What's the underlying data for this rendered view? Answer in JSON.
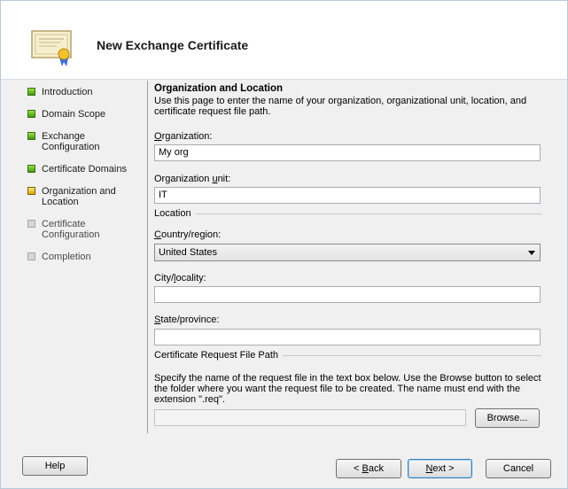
{
  "window": {
    "title": "New Exchange Certificate"
  },
  "steps": [
    {
      "label": "Introduction",
      "state": "done"
    },
    {
      "label": "Domain Scope",
      "state": "done"
    },
    {
      "label": "Exchange Configuration",
      "state": "done"
    },
    {
      "label": "Certificate Domains",
      "state": "done"
    },
    {
      "label": "Organization and Location",
      "state": "current"
    },
    {
      "label": "Certificate Configuration",
      "state": "pending"
    },
    {
      "label": "Completion",
      "state": "pending"
    }
  ],
  "page": {
    "heading": "Organization and Location",
    "description": "Use this page to enter the name of your organization, organizational unit, location, and certificate request file path."
  },
  "fields": {
    "organization": {
      "label_pre": "",
      "label_u": "O",
      "label_post": "rganization:",
      "value": "My org"
    },
    "org_unit": {
      "label_pre": "Organization ",
      "label_u": "u",
      "label_post": "nit:",
      "value": "IT"
    },
    "location_group": "Location",
    "country": {
      "label_pre": "",
      "label_u": "C",
      "label_post": "ountry/region:",
      "value": "United States"
    },
    "city": {
      "label_pre": "City/",
      "label_u": "l",
      "label_post": "ocality:",
      "value": ""
    },
    "state": {
      "label_pre": "",
      "label_u": "S",
      "label_post": "tate/province:",
      "value": ""
    },
    "file_group": "Certificate Request File Path",
    "file_desc": "Specify the name of the request file in the text box below. Use the Browse button to select the folder where you want the request file to be created. The name must end with the extension \".req\".",
    "file_path": {
      "value": ""
    }
  },
  "buttons": {
    "browse": "Browse...",
    "help": "Help",
    "back_pre": "< ",
    "back_u": "B",
    "back_post": "ack",
    "next_u": "N",
    "next_post": "ext >",
    "cancel": "Cancel"
  },
  "colors": {
    "step_done": "#3f9b0c",
    "step_current": "#d9a500",
    "step_pending": "#d6d6d6"
  }
}
